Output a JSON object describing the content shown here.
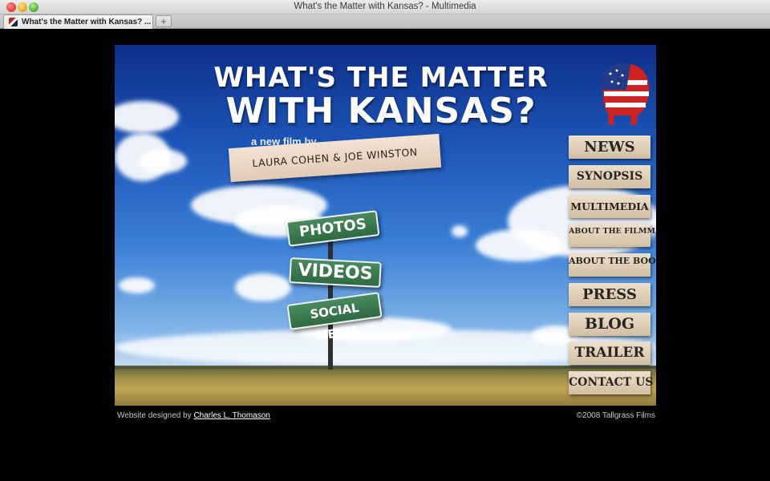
{
  "window": {
    "title": "What's the Matter with Kansas? - Multimedia"
  },
  "tabs": [
    {
      "label": "What's the Matter with Kansas? ...",
      "active": true
    }
  ],
  "new_tab_label": "+",
  "site": {
    "headline_line1": "WHAT'S THE MATTER",
    "headline_line2": "WITH KANSAS?",
    "byline": "a new film by",
    "credit": "LAURA COHEN & JOE WINSTON",
    "signs": {
      "photos": "PHOTOS",
      "videos": "VIDEOS",
      "social": "SOCIAL MEDIA"
    },
    "nav": [
      {
        "label": "NEWS"
      },
      {
        "label": "SYNOPSIS"
      },
      {
        "label": "MULTIMEDIA"
      },
      {
        "label": "ABOUT THE FILMMAKERS"
      },
      {
        "label": "ABOUT THE BOOK"
      },
      {
        "label": "PRESS"
      },
      {
        "label": "BLOG"
      },
      {
        "label": "TRAILER"
      },
      {
        "label": "CONTACT US"
      }
    ]
  },
  "footer": {
    "designed_prefix": "Website designed by",
    "designer_link": "Charles L. Thomason",
    "copyright": "©2008 Tallgrass Films"
  },
  "colors": {
    "sky_top": "#0e2f8a",
    "sign_green": "#2f6a42",
    "paper": "#ece0cd",
    "page_bg": "#000000"
  },
  "icons": {
    "logo": "flag-bison-icon",
    "favicon": "site-favicon-icon"
  }
}
